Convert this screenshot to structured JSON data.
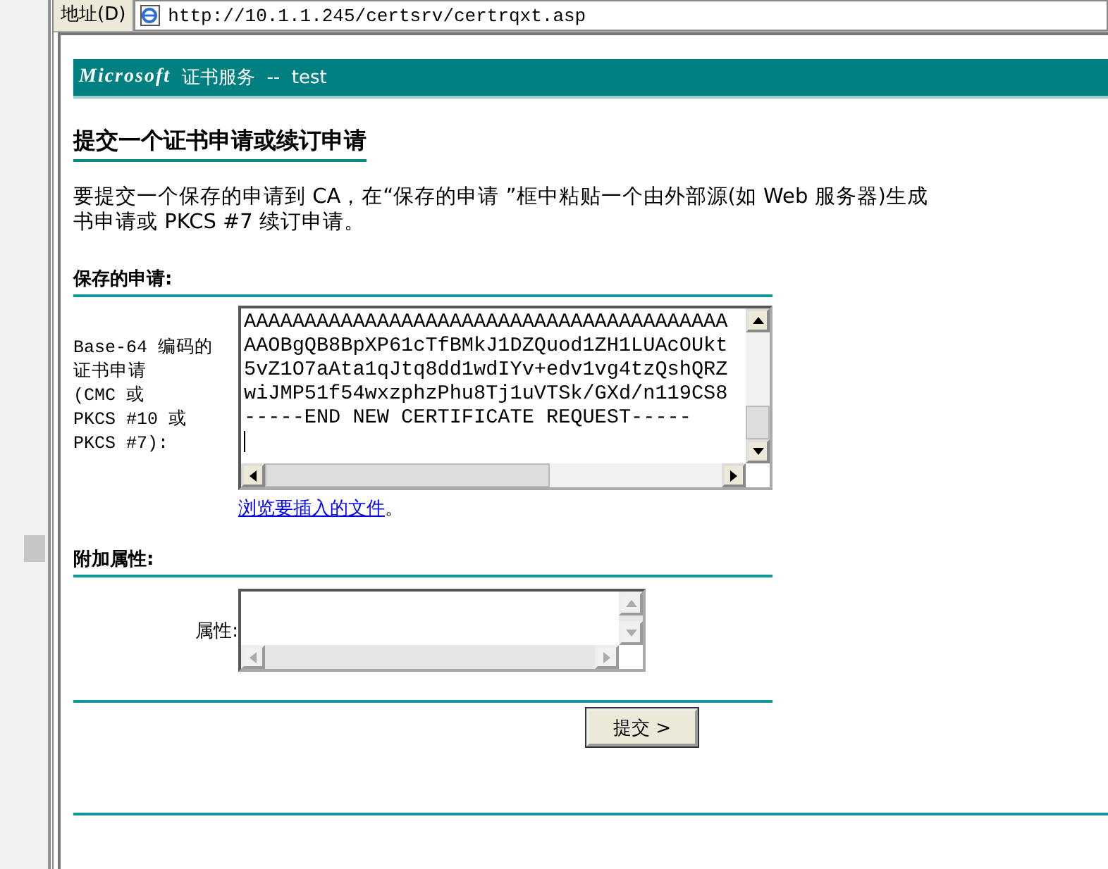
{
  "address_bar": {
    "label": "地址(D)",
    "url": "http://10.1.1.245/certsrv/certrqxt.asp"
  },
  "banner": {
    "brand": "Microsoft",
    "title": "证书服务  --  test"
  },
  "heading": "提交一个证书申请或续订申请",
  "intro_lines": [
    "要提交一个保存的申请到 CA，在“保存的申请 ”框中粘贴一个由外部源(如 Web 服务器)生成",
    "书申请或 PKCS #7 续订申请。"
  ],
  "saved_request": {
    "section_title": "保存的申请:",
    "label_lines": [
      "Base-64 编码的",
      "证书申请",
      "(CMC 或",
      "PKCS #10 或",
      "PKCS #7):"
    ],
    "value_lines": [
      "AAAAAAAAAAAAAAAAAAAAAAAAAAAAAAAAAAAAAAAA",
      "AAOBgQB8BpXP61cTfBMkJ1DZQuod1ZH1LUAcOUkt",
      "5vZ1O7aAta1qJtq8dd1wdIYv+edv1vg4tzQshQRZ",
      "wiJMP51f54wxzphzPhu8Tj1uVTSk/GXd/n119CS8",
      "-----END NEW CERTIFICATE REQUEST-----"
    ],
    "browse_link": "浏览要插入的文件",
    "browse_suffix": "。"
  },
  "attributes": {
    "section_title": "附加属性:",
    "label": "属性:",
    "disabled": true
  },
  "submit_button": "提交 >"
}
